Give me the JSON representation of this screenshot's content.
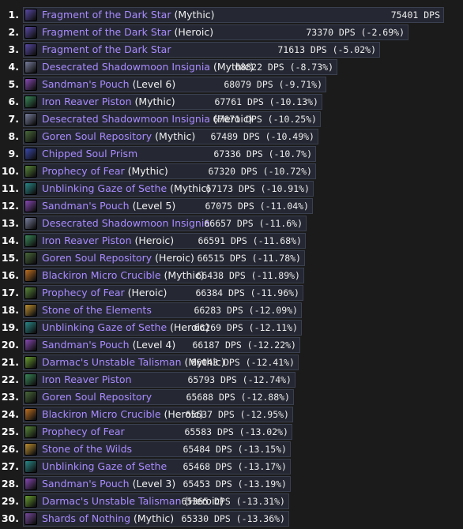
{
  "rows": [
    {
      "rank": "1.",
      "name": "Fragment of the Dark Star",
      "qual": " (Mythic)",
      "dps": "75401 DPS",
      "icon": "fragment-dark-star-icon",
      "color": "#5a4aa8"
    },
    {
      "rank": "2.",
      "name": "Fragment of the Dark Star",
      "qual": " (Heroic)",
      "dps": "73370 DPS (-2.69%)",
      "icon": "fragment-dark-star-icon",
      "color": "#5a4aa8"
    },
    {
      "rank": "3.",
      "name": "Fragment of the Dark Star",
      "qual": "",
      "dps": "71613 DPS (-5.02%)",
      "icon": "fragment-dark-star-icon",
      "color": "#5a4aa8"
    },
    {
      "rank": "4.",
      "name": "Desecrated Shadowmoon Insignia",
      "qual": " (Mythic)",
      "dps": "68822 DPS (-8.73%)",
      "icon": "insignia-icon",
      "color": "#7a80a0"
    },
    {
      "rank": "5.",
      "name": "Sandman's Pouch",
      "qual": " (Level 6)",
      "dps": "68079 DPS (-9.71%)",
      "icon": "pouch-icon",
      "color": "#8a4ab8"
    },
    {
      "rank": "6.",
      "name": "Iron Reaver Piston",
      "qual": " (Mythic)",
      "dps": "67761 DPS (-10.13%)",
      "icon": "piston-icon",
      "color": "#3a8a5a"
    },
    {
      "rank": "7.",
      "name": "Desecrated Shadowmoon Insignia",
      "qual": " (Heroic)",
      "dps": "67671 DPS (-10.25%)",
      "icon": "insignia-icon",
      "color": "#7a80a0"
    },
    {
      "rank": "8.",
      "name": "Goren Soul Repository",
      "qual": " (Mythic)",
      "dps": "67489 DPS (-10.49%)",
      "icon": "soul-repository-icon",
      "color": "#4a6a3a"
    },
    {
      "rank": "9.",
      "name": "Chipped Soul Prism",
      "qual": "",
      "dps": "67336 DPS (-10.7%)",
      "icon": "soul-prism-icon",
      "color": "#3a4ab0"
    },
    {
      "rank": "10.",
      "name": "Prophecy of Fear",
      "qual": " (Mythic)",
      "dps": "67320 DPS (-10.72%)",
      "icon": "prophecy-icon",
      "color": "#5a8a3a"
    },
    {
      "rank": "11.",
      "name": "Unblinking Gaze of Sethe",
      "qual": " (Mythic)",
      "dps": "67173 DPS (-10.91%)",
      "icon": "gaze-icon",
      "color": "#2a8a8a"
    },
    {
      "rank": "12.",
      "name": "Sandman's Pouch",
      "qual": " (Level 5)",
      "dps": "67075 DPS (-11.04%)",
      "icon": "pouch-icon",
      "color": "#8a4ab8"
    },
    {
      "rank": "13.",
      "name": "Desecrated Shadowmoon Insignia",
      "qual": "",
      "dps": "66657 DPS (-11.6%)",
      "icon": "insignia-icon",
      "color": "#7a80a0"
    },
    {
      "rank": "14.",
      "name": "Iron Reaver Piston",
      "qual": " (Heroic)",
      "dps": "66591 DPS (-11.68%)",
      "icon": "piston-icon",
      "color": "#3a8a5a"
    },
    {
      "rank": "15.",
      "name": "Goren Soul Repository",
      "qual": " (Heroic)",
      "dps": "66515 DPS (-11.78%)",
      "icon": "soul-repository-icon",
      "color": "#4a6a3a"
    },
    {
      "rank": "16.",
      "name": "Blackiron Micro Crucible",
      "qual": " (Mythic)",
      "dps": "66438 DPS (-11.89%)",
      "icon": "crucible-icon",
      "color": "#c07020"
    },
    {
      "rank": "17.",
      "name": "Prophecy of Fear",
      "qual": " (Heroic)",
      "dps": "66384 DPS (-11.96%)",
      "icon": "prophecy-icon",
      "color": "#5a8a3a"
    },
    {
      "rank": "18.",
      "name": "Stone of the Elements",
      "qual": "",
      "dps": "66283 DPS (-12.09%)",
      "icon": "stone-icon",
      "color": "#c09030"
    },
    {
      "rank": "19.",
      "name": "Unblinking Gaze of Sethe",
      "qual": " (Heroic)",
      "dps": "66269 DPS (-12.11%)",
      "icon": "gaze-icon",
      "color": "#2a8a8a"
    },
    {
      "rank": "20.",
      "name": "Sandman's Pouch",
      "qual": " (Level 4)",
      "dps": "66187 DPS (-12.22%)",
      "icon": "pouch-icon",
      "color": "#8a4ab8"
    },
    {
      "rank": "21.",
      "name": "Darmac's Unstable Talisman",
      "qual": " (Mythic)",
      "dps": "66043 DPS (-12.41%)",
      "icon": "talisman-icon",
      "color": "#6aa030"
    },
    {
      "rank": "22.",
      "name": "Iron Reaver Piston",
      "qual": "",
      "dps": "65793 DPS (-12.74%)",
      "icon": "piston-icon",
      "color": "#3a8a5a"
    },
    {
      "rank": "23.",
      "name": "Goren Soul Repository",
      "qual": "",
      "dps": "65688 DPS (-12.88%)",
      "icon": "soul-repository-icon",
      "color": "#4a6a3a"
    },
    {
      "rank": "24.",
      "name": "Blackiron Micro Crucible",
      "qual": " (Heroic)",
      "dps": "65637 DPS (-12.95%)",
      "icon": "crucible-icon",
      "color": "#c07020"
    },
    {
      "rank": "25.",
      "name": "Prophecy of Fear",
      "qual": "",
      "dps": "65583 DPS (-13.02%)",
      "icon": "prophecy-icon",
      "color": "#5a8a3a"
    },
    {
      "rank": "26.",
      "name": "Stone of the Wilds",
      "qual": "",
      "dps": "65484 DPS (-13.15%)",
      "icon": "stone-icon",
      "color": "#c09030"
    },
    {
      "rank": "27.",
      "name": "Unblinking Gaze of Sethe",
      "qual": "",
      "dps": "65468 DPS (-13.17%)",
      "icon": "gaze-icon",
      "color": "#2a8a8a"
    },
    {
      "rank": "28.",
      "name": "Sandman's Pouch",
      "qual": " (Level 3)",
      "dps": "65453 DPS (-13.19%)",
      "icon": "pouch-icon",
      "color": "#8a4ab8"
    },
    {
      "rank": "29.",
      "name": "Darmac's Unstable Talisman",
      "qual": " (Heroic)",
      "dps": "65365 DPS (-13.31%)",
      "icon": "talisman-icon",
      "color": "#6aa030"
    },
    {
      "rank": "30.",
      "name": "Shards of Nothing",
      "qual": " (Mythic)",
      "dps": "65330 DPS (-13.36%)",
      "icon": "shards-icon",
      "color": "#7a4aa0"
    }
  ]
}
